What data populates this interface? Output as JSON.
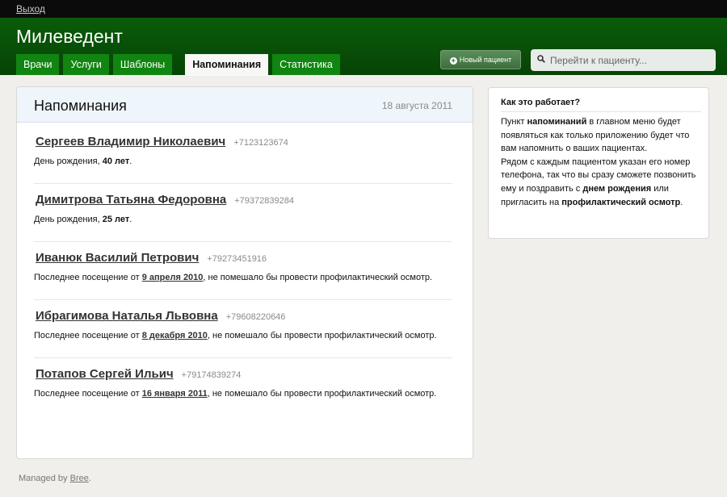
{
  "topbar": {
    "logout": "Выход"
  },
  "header": {
    "title": "Милеведент",
    "tabs": [
      {
        "label": "Врачи"
      },
      {
        "label": "Услуги"
      },
      {
        "label": "Шаблоны"
      },
      {
        "label": "Напоминания",
        "active": true
      },
      {
        "label": "Статистика"
      }
    ],
    "new_patient_label": "Новый пациент",
    "search_placeholder": "Перейти к пациенту..."
  },
  "reminders": {
    "title": "Напоминания",
    "date": "18 августа 2011",
    "entries": [
      {
        "name": "Сергеев Владимир Николаевич",
        "phone": "+7123123674",
        "prefix": "День рождения, ",
        "highlight": "40 лет",
        "suffix": "."
      },
      {
        "name": "Димитрова Татьяна Федоровна",
        "phone": "+79372839284",
        "prefix": "День рождения, ",
        "highlight": "25 лет",
        "suffix": "."
      },
      {
        "name": "Иванюк Василий Петрович",
        "phone": "+79273451916",
        "prefix": "Последнее посещение от ",
        "highlight": "9 апреля 2010",
        "suffix": ", не помешало бы провести профилактический осмотр."
      },
      {
        "name": "Ибрагимова Наталья Львовна",
        "phone": "+79608220646",
        "prefix": "Последнее посещение от ",
        "highlight": "8 декабря 2010",
        "suffix": ", не помешало бы провести профилактический осмотр."
      },
      {
        "name": "Потапов Сергей Ильич",
        "phone": "+79174839274",
        "prefix": "Последнее посещение от ",
        "highlight": "16 января 2011",
        "suffix": ", не помешало бы провести профилактический осмотр."
      }
    ]
  },
  "help": {
    "title": "Как это работает?",
    "p1_a": "Пункт ",
    "p1_b": "напоминаний",
    "p1_c": " в главном меню будет появляться как только приложению будет что вам напомнить о ваших пациентах.",
    "p2_a": "Рядом с каждым пациентом указан его номер телефона, так что вы сразу сможете позвонить ему и поздравить с ",
    "p2_b": "днем рождения",
    "p2_c": " или пригласить на ",
    "p2_d": "профилактический осмотр",
    "p2_e": "."
  },
  "footer": {
    "prefix": "Managed by ",
    "link": "Bree",
    "suffix": "."
  },
  "colors": {
    "header_green": "#0a5c0a",
    "tab_green": "#118511",
    "panel_head": "#eef5fb"
  }
}
